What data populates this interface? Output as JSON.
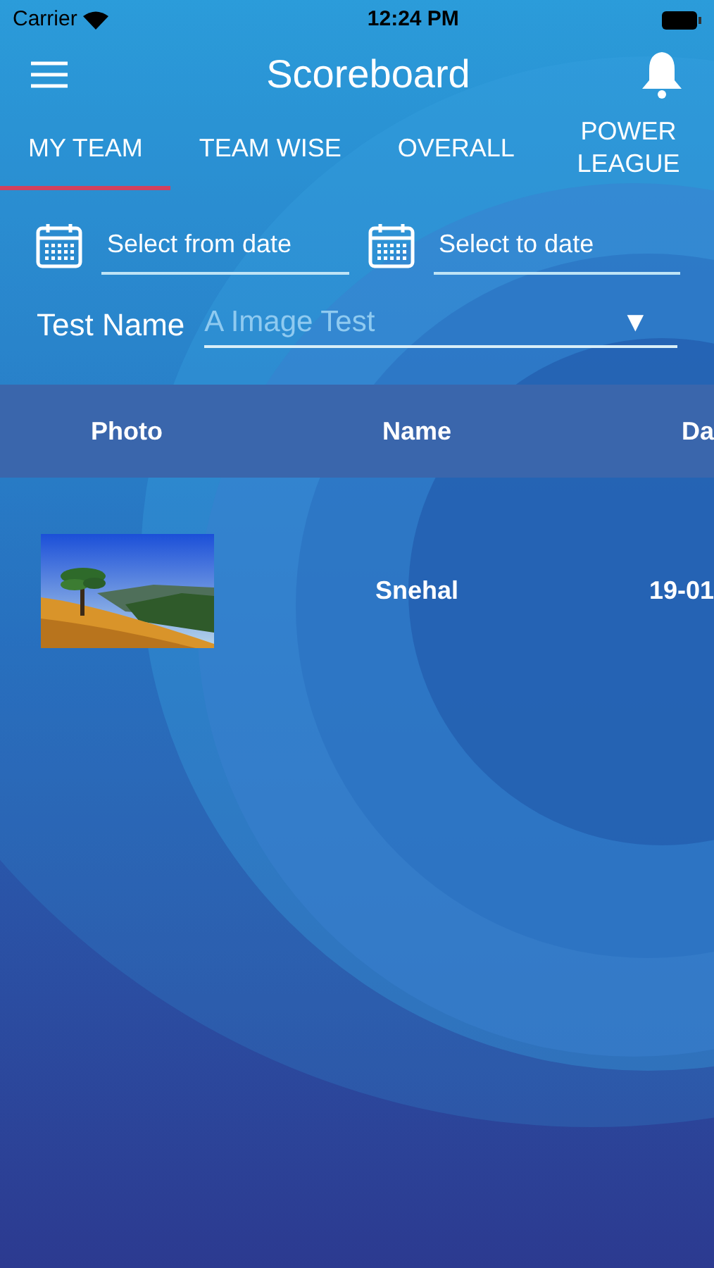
{
  "status_bar": {
    "carrier": "Carrier",
    "time": "12:24 PM"
  },
  "header": {
    "title": "Scoreboard"
  },
  "tabs": [
    {
      "label": "MY TEAM",
      "selected": true
    },
    {
      "label": "TEAM WISE",
      "selected": false
    },
    {
      "label": "OVERALL",
      "selected": false
    },
    {
      "label": "POWER LEAGUE",
      "selected": false
    }
  ],
  "date_filters": [
    {
      "placeholder": "Select from date"
    },
    {
      "placeholder": "Select to date"
    }
  ],
  "test_filter": {
    "label": "Test Name",
    "value": "A Image Test",
    "arrow": "▼"
  },
  "table": {
    "columns": [
      "Photo",
      "Name",
      "Da"
    ],
    "rows": [
      {
        "name": "Snehal",
        "column_3": "19-01"
      }
    ]
  }
}
